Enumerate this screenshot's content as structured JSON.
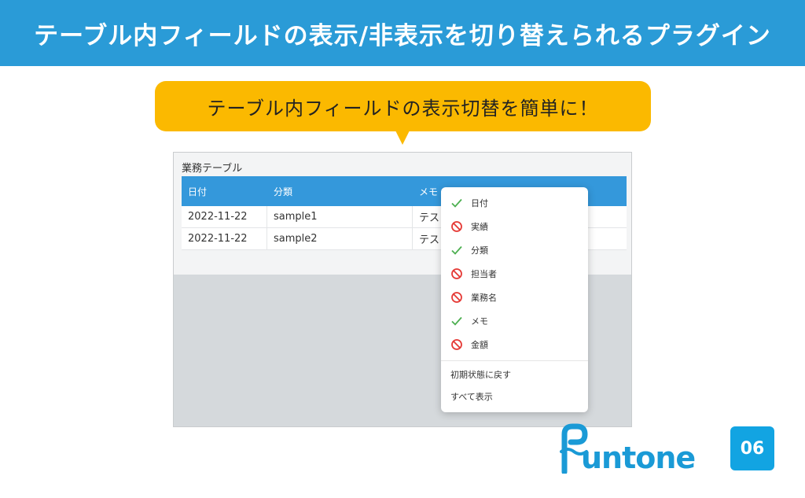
{
  "header": {
    "title": "テーブル内フィールドの表示/非表示を切り替えられるプラグイン"
  },
  "bubble": {
    "text": "テーブル内フィールドの表示切替を簡単に！"
  },
  "table": {
    "caption": "業務テーブル",
    "columns": [
      "日付",
      "分類",
      "メモ"
    ],
    "rows": [
      [
        "2022-11-22",
        "sample1",
        "テス"
      ],
      [
        "2022-11-22",
        "sample2",
        "テス"
      ]
    ]
  },
  "menu": {
    "items": [
      {
        "label": "日付",
        "state": "visible",
        "icon": "check-icon"
      },
      {
        "label": "実績",
        "state": "hidden",
        "icon": "prohibited-icon"
      },
      {
        "label": "分類",
        "state": "visible",
        "icon": "check-icon"
      },
      {
        "label": "担当者",
        "state": "hidden",
        "icon": "prohibited-icon"
      },
      {
        "label": "業務名",
        "state": "hidden",
        "icon": "prohibited-icon"
      },
      {
        "label": "メモ",
        "state": "visible",
        "icon": "check-icon"
      },
      {
        "label": "金額",
        "state": "hidden",
        "icon": "prohibited-icon"
      }
    ],
    "reset_label": "初期状態に戻す",
    "show_all_label": "すべて表示"
  },
  "logo": {
    "text": "untone"
  },
  "badge": {
    "text": "06"
  },
  "colors": {
    "header": "#2a9bd7",
    "bubble": "#fbb900",
    "table_header": "#3498db",
    "check": "#4caf50",
    "prohibited": "#e53935",
    "logo": "#1a9ad6"
  }
}
